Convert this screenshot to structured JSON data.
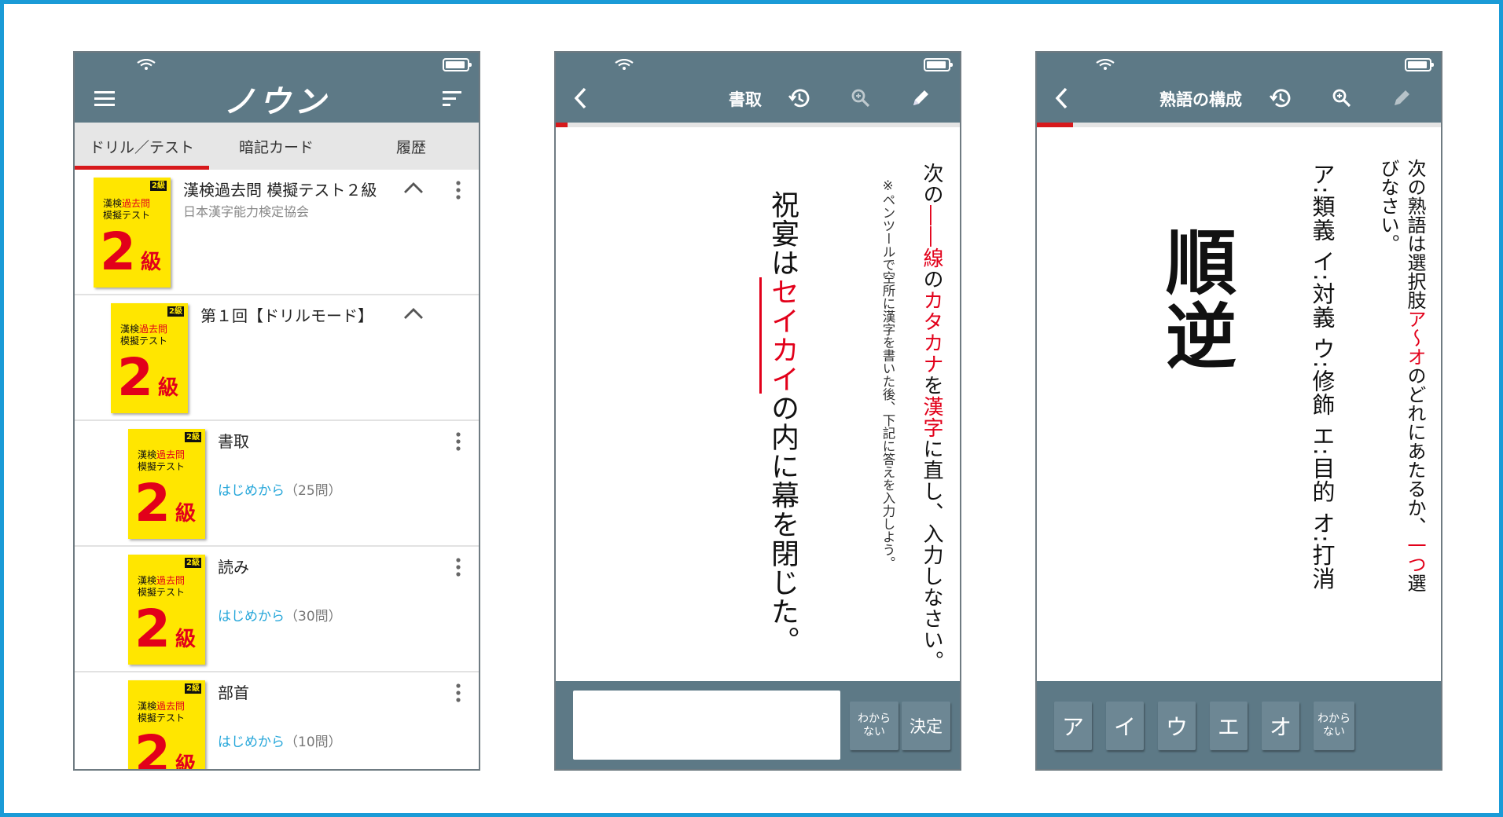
{
  "phone1": {
    "app_title": "ノウン",
    "tabs": [
      {
        "label": "ドリル／テスト",
        "active": true
      },
      {
        "label": "暗記カード",
        "active": false
      },
      {
        "label": "履歴",
        "active": false
      }
    ],
    "cover": {
      "badge": "2級",
      "line1_a": "漢検",
      "line1_b": "過去問",
      "line2": "模擬テスト",
      "number": "2",
      "unit": "級"
    },
    "items": [
      {
        "title": "漢検過去問 模擬テスト２級",
        "subtitle": "日本漢字能力検定協会"
      },
      {
        "title": "第１回【ドリルモード】"
      },
      {
        "title": "書取",
        "link": "はじめから",
        "count": "（25問）"
      },
      {
        "title": "読み",
        "link": "はじめから",
        "count": "（30問）"
      },
      {
        "title": "部首",
        "link": "はじめから",
        "count": "（10問）"
      }
    ]
  },
  "phone2": {
    "title": "書取",
    "progress": 0.03,
    "instruction": {
      "p1": "次の",
      "p2": "――線",
      "p3": "の",
      "p4": "カタカナ",
      "p5": "を",
      "p6": "漢字",
      "p7": "に直し、入力しなさい。"
    },
    "note": "※ペンツールで空所に漢字を書いた後、下記に答えを入力しよう。",
    "question": {
      "p1": "祝宴は",
      "p2": "セイカイ",
      "p3": "の内に幕を閉じた。"
    },
    "keys": {
      "unknown": "わからない",
      "unknown_1": "わから",
      "unknown_2": "ない",
      "submit": "決定"
    },
    "answer_value": ""
  },
  "phone3": {
    "title": "熟語の構成",
    "progress": 0.09,
    "instruction_line1": "次の熟語は選択肢",
    "instruction_red1": "ア～オ",
    "instruction_line1b": "のどれにあたるか、",
    "instruction_red2": "一つ",
    "instruction_line1c": "選",
    "instruction_line2": "びなさい。",
    "choices": "ア:類義 イ:対義 ウ:修飾 エ:目的 オ:打消",
    "word": "順逆",
    "keys": [
      "ア",
      "イ",
      "ウ",
      "エ",
      "オ"
    ],
    "unknown_1": "わから",
    "unknown_2": "ない"
  },
  "colors": {
    "header": "#5d7986",
    "accent": "#d7191c",
    "link": "#27a7da",
    "cover": "#ffe600",
    "frame": "#1a9bd7"
  },
  "icons": [
    "menu-icon",
    "sort-icon",
    "back-icon",
    "history-icon",
    "search-icon",
    "pen-icon",
    "wifi-icon",
    "battery-icon",
    "chevron-up-icon",
    "more-vertical-icon"
  ]
}
